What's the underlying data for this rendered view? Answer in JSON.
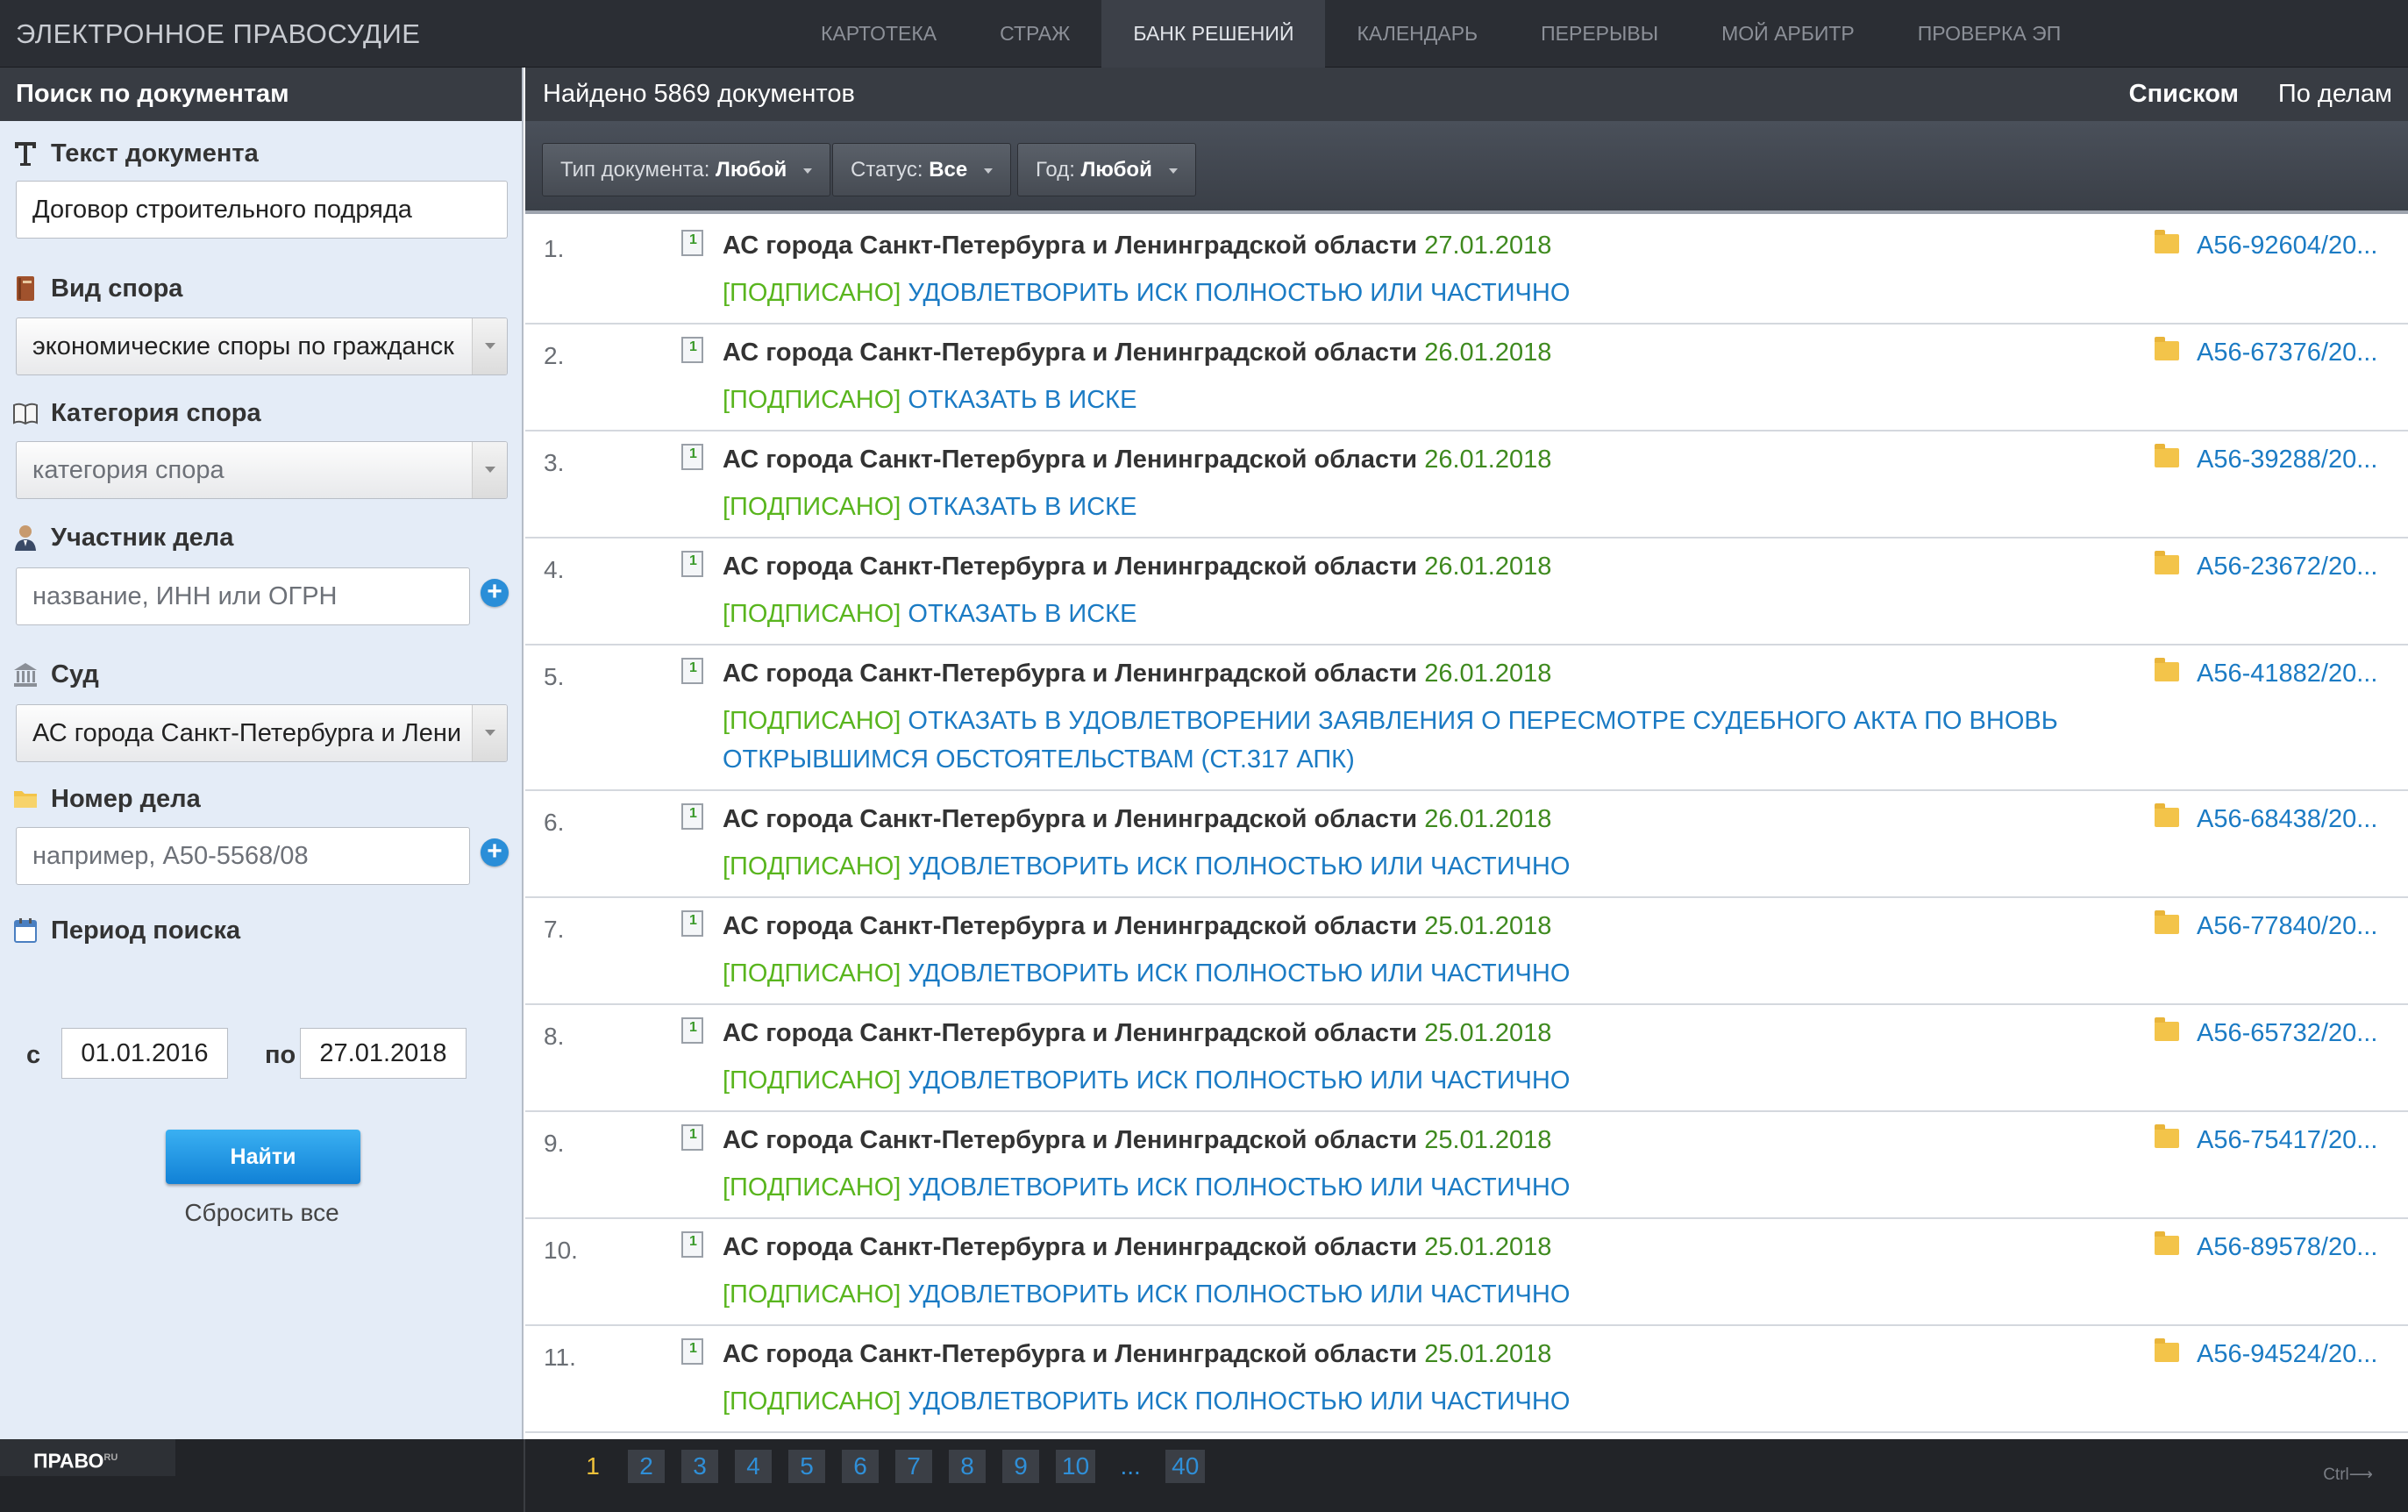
{
  "brand": "ЭЛЕКТРОННОЕ ПРАВОСУДИЕ",
  "nav": [
    {
      "label": "КАРТОТЕКА"
    },
    {
      "label": "СТРАЖ"
    },
    {
      "label": "БАНК РЕШЕНИЙ"
    },
    {
      "label": "КАЛЕНДАРЬ"
    },
    {
      "label": "ПЕРЕРЫВЫ"
    },
    {
      "label": "МОЙ АРБИТР"
    },
    {
      "label": "ПРОВЕРКА ЭП"
    }
  ],
  "active_nav": "БАНК РЕШЕНИЙ",
  "sidebar": {
    "title": "Поиск по документам",
    "text_label": "Текст документа",
    "text_value": "Договор строительного подряда",
    "dispute_type_label": "Вид спора",
    "dispute_type_value": "экономические споры по гражданск",
    "category_label": "Категория спора",
    "category_placeholder": "категория спора",
    "participant_label": "Участник дела",
    "participant_placeholder": "название, ИНН или ОГРН",
    "court_label": "Суд",
    "court_value": "АС города Санкт-Петербурга и Лени",
    "case_number_label": "Номер дела",
    "case_number_placeholder": "например, А50-5568/08",
    "period_label": "Период поиска",
    "from_label": "с",
    "from_value": "01.01.2016",
    "to_label": "по",
    "to_value": "27.01.2018",
    "find_button": "Найти",
    "reset_link": "Сбросить все"
  },
  "main": {
    "found_text": "Найдено 5869 документов",
    "view_list": "Списком",
    "view_cases": "По делам",
    "filters": {
      "doc_type_label": "Тип документа:",
      "doc_type_value": "Любой",
      "status_label": "Статус:",
      "status_value": "Все",
      "year_label": "Год:",
      "year_value": "Любой"
    }
  },
  "results": [
    {
      "num": "1.",
      "court": "АС города Санкт-Петербурга и Ленинградской области",
      "date": "27.01.2018",
      "status": "[ПОДПИСАНО]",
      "decision": "УДОВЛЕТВОРИТЬ ИСК ПОЛНОСТЬЮ ИЛИ ЧАСТИЧНО",
      "case": "А56-92604/20..."
    },
    {
      "num": "2.",
      "court": "АС города Санкт-Петербурга и Ленинградской области",
      "date": "26.01.2018",
      "status": "[ПОДПИСАНО]",
      "decision": "ОТКАЗАТЬ В ИСКЕ",
      "case": "А56-67376/20..."
    },
    {
      "num": "3.",
      "court": "АС города Санкт-Петербурга и Ленинградской области",
      "date": "26.01.2018",
      "status": "[ПОДПИСАНО]",
      "decision": "ОТКАЗАТЬ В ИСКЕ",
      "case": "А56-39288/20..."
    },
    {
      "num": "4.",
      "court": "АС города Санкт-Петербурга и Ленинградской области",
      "date": "26.01.2018",
      "status": "[ПОДПИСАНО]",
      "decision": "ОТКАЗАТЬ В ИСКЕ",
      "case": "А56-23672/20..."
    },
    {
      "num": "5.",
      "court": "АС города Санкт-Петербурга и Ленинградской области",
      "date": "26.01.2018",
      "status": "[ПОДПИСАНО]",
      "decision": "ОТКАЗАТЬ В УДОВЛЕТВОРЕНИИ ЗАЯВЛЕНИЯ О ПЕРЕСМОТРЕ СУДЕБНОГО АКТА ПО ВНОВЬ ОТКРЫВШИМСЯ ОБСТОЯТЕЛЬСТВАМ (СТ.317 АПК)",
      "case": "А56-41882/20..."
    },
    {
      "num": "6.",
      "court": "АС города Санкт-Петербурга и Ленинградской области",
      "date": "26.01.2018",
      "status": "[ПОДПИСАНО]",
      "decision": "УДОВЛЕТВОРИТЬ ИСК ПОЛНОСТЬЮ ИЛИ ЧАСТИЧНО",
      "case": "А56-68438/20..."
    },
    {
      "num": "7.",
      "court": "АС города Санкт-Петербурга и Ленинградской области",
      "date": "25.01.2018",
      "status": "[ПОДПИСАНО]",
      "decision": "УДОВЛЕТВОРИТЬ ИСК ПОЛНОСТЬЮ ИЛИ ЧАСТИЧНО",
      "case": "А56-77840/20..."
    },
    {
      "num": "8.",
      "court": "АС города Санкт-Петербурга и Ленинградской области",
      "date": "25.01.2018",
      "status": "[ПОДПИСАНО]",
      "decision": "УДОВЛЕТВОРИТЬ ИСК ПОЛНОСТЬЮ ИЛИ ЧАСТИЧНО",
      "case": "А56-65732/20..."
    },
    {
      "num": "9.",
      "court": "АС города Санкт-Петербурга и Ленинградской области",
      "date": "25.01.2018",
      "status": "[ПОДПИСАНО]",
      "decision": "УДОВЛЕТВОРИТЬ ИСК ПОЛНОСТЬЮ ИЛИ ЧАСТИЧНО",
      "case": "А56-75417/20..."
    },
    {
      "num": "10.",
      "court": "АС города Санкт-Петербурга и Ленинградской области",
      "date": "25.01.2018",
      "status": "[ПОДПИСАНО]",
      "decision": "УДОВЛЕТВОРИТЬ ИСК ПОЛНОСТЬЮ ИЛИ ЧАСТИЧНО",
      "case": "А56-89578/20..."
    },
    {
      "num": "11.",
      "court": "АС города Санкт-Петербурга и Ленинградской области",
      "date": "25.01.2018",
      "status": "[ПОДПИСАНО]",
      "decision": "УДОВЛЕТВОРИТЬ ИСК ПОЛНОСТЬЮ ИЛИ ЧАСТИЧНО",
      "case": "А56-94524/20..."
    }
  ],
  "footer": {
    "brand": "ПРАВО",
    "brand_sup": "RU",
    "pages": [
      "1",
      "2",
      "3",
      "4",
      "5",
      "6",
      "7",
      "8",
      "9",
      "10",
      "...",
      "40"
    ],
    "current_page": "1",
    "ctrl_hint": "Ctrl⟶"
  },
  "colors": {
    "topbar": "#2b2e34",
    "sidebar_bg": "#e4ecf7",
    "date_green": "#3f8a1f",
    "signed_green": "#59b51e",
    "link_blue": "#1b7bc4",
    "page_current": "#f0c23a"
  },
  "icons": [
    "text-icon",
    "book-icon",
    "open-book-icon",
    "user-icon",
    "bank-icon",
    "folder-icon",
    "calendar-icon",
    "plus-icon",
    "document-icon",
    "dropdown-arrow-icon"
  ]
}
